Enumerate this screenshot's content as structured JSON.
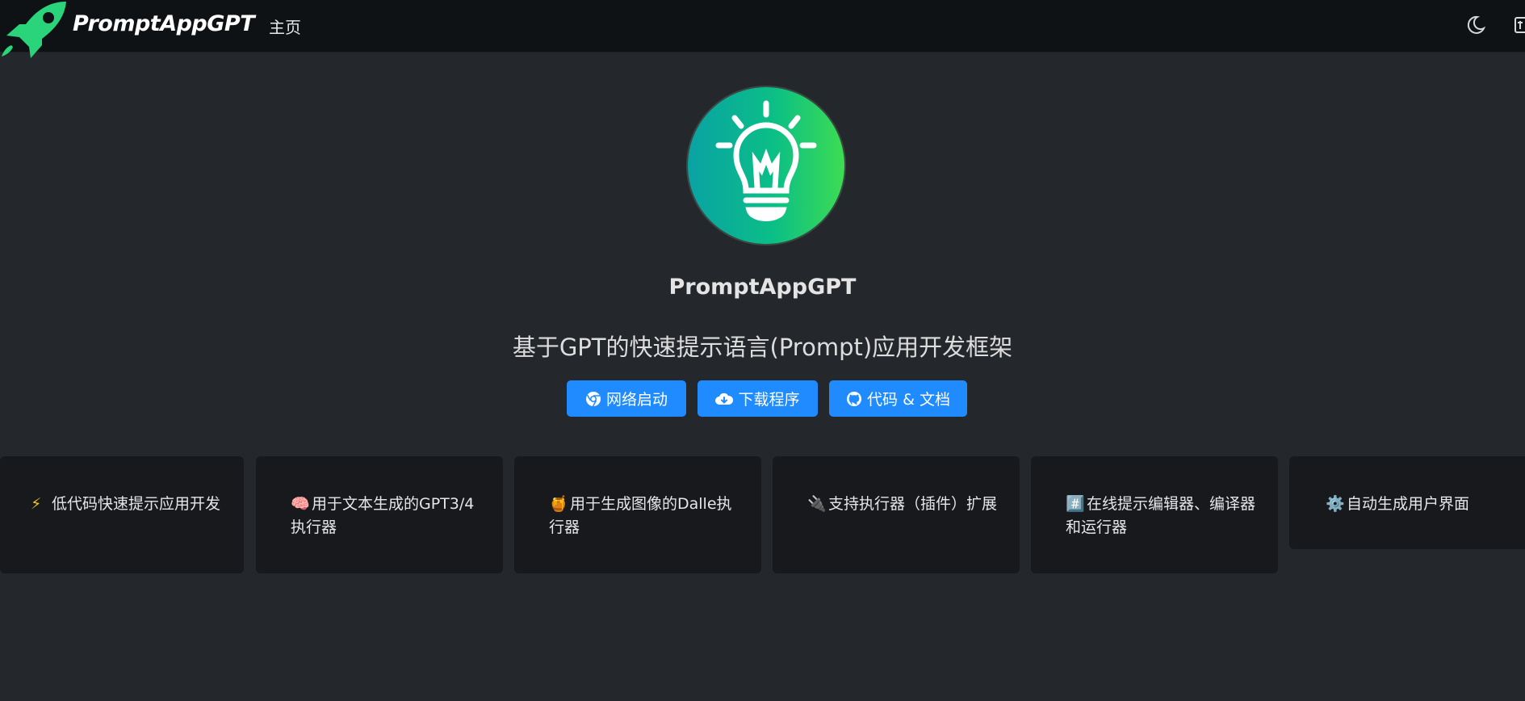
{
  "navbar": {
    "brand": "PromptAppGPT",
    "home_link": "主页"
  },
  "hero": {
    "title": "PromptAppGPT",
    "tagline": "基于GPT的快速提示语言(Prompt)应用开发框架"
  },
  "buttons": [
    {
      "label": "网络启动",
      "icon": "chrome-icon"
    },
    {
      "label": "下载程序",
      "icon": "cloud-download-icon"
    },
    {
      "label": "代码 & 文档",
      "icon": "github-icon"
    }
  ],
  "features": [
    {
      "emoji": "⚡",
      "text": "低代码快速提示应用开发"
    },
    {
      "emoji": "🧠",
      "text": "用于文本生成的GPT3/4执行器"
    },
    {
      "emoji": "🍯",
      "text": "用于生成图像的Dalle执行器"
    },
    {
      "emoji": "🔌",
      "text": "支持执行器（插件）扩展"
    },
    {
      "emoji": "#️⃣",
      "text": "在线提示编辑器、编译器和运行器"
    },
    {
      "emoji": "⚙️",
      "text": "自动生成用户界面"
    }
  ],
  "colors": {
    "page_bg": "#24272c",
    "navbar_bg": "#0f1215",
    "button_bg": "#1f8bff",
    "card_bg": "#17191d",
    "brand_green": "#2ad47a"
  }
}
